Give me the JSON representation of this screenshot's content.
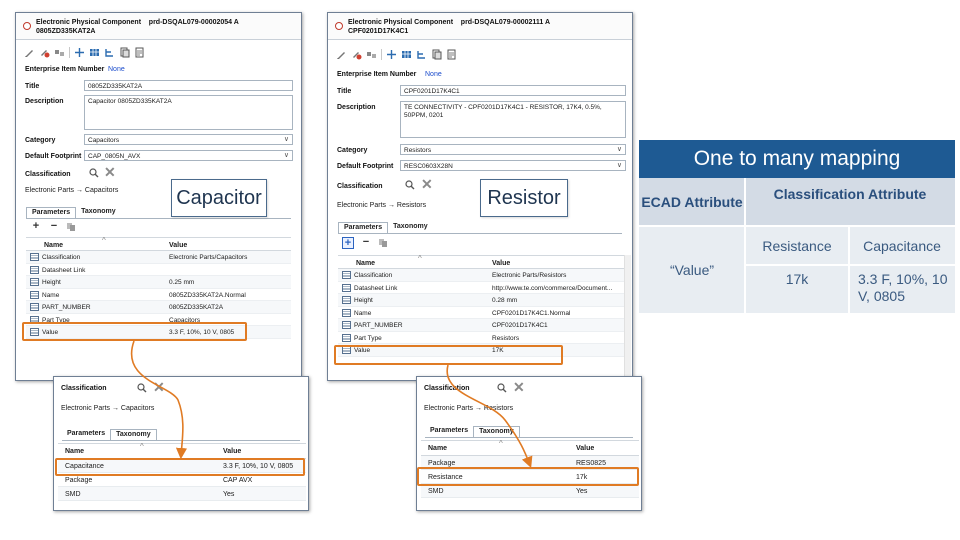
{
  "left_window": {
    "header": "Electronic Physical Component    prd-DSQAL079-00002054 A\n0805ZD335KAT2A",
    "enterprise_label": "Enterprise Item Number",
    "enterprise_value": "None",
    "title_label": "Title",
    "title_value": "0805ZD335KAT2A",
    "description_label": "Description",
    "description_value": "Capacitor 0805ZD335KAT2A",
    "category_label": "Category",
    "category_value": "Capacitors",
    "footprint_label": "Default Footprint",
    "footprint_value": "CAP_0805N_AVX",
    "classification_label": "Classification",
    "classification_path": "Electronic Parts → Capacitors",
    "tabs": [
      "Parameters",
      "Taxonomy"
    ],
    "grid_headers": [
      "Name",
      "Value"
    ],
    "rows": [
      {
        "name": "Classification",
        "value": "Electronic Parts/Capacitors"
      },
      {
        "name": "Datasheet Link",
        "value": ""
      },
      {
        "name": "Height",
        "value": "0.25 mm"
      },
      {
        "name": "Name",
        "value": "0805ZD335KAT2A.Normal"
      },
      {
        "name": "PART_NUMBER",
        "value": "0805ZD335KAT2A"
      },
      {
        "name": "Part Type",
        "value": "Capacitors"
      },
      {
        "name": "Value",
        "value": "3.3 F, 10%, 10 V, 0805"
      }
    ]
  },
  "right_window": {
    "header": "Electronic Physical Component    prd-DSQAL079-00002111 A\nCPF0201D17K4C1",
    "enterprise_label": "Enterprise Item Number",
    "enterprise_value": "None",
    "title_label": "Title",
    "title_value": "CPF0201D17K4C1",
    "description_label": "Description",
    "description_value": "TE CONNECTIVITY - CPF0201D17K4C1 - RESISTOR, 17K4, 0.5%, 50PPM, 0201",
    "category_label": "Category",
    "category_value": "Resistors",
    "footprint_label": "Default Footprint",
    "footprint_value": "RESC0603X28N",
    "classification_label": "Classification",
    "classification_path": "Electronic Parts → Resistors",
    "tabs": [
      "Parameters",
      "Taxonomy"
    ],
    "grid_headers": [
      "Name",
      "Value"
    ],
    "rows": [
      {
        "name": "Classification",
        "value": "Electronic Parts/Resistors"
      },
      {
        "name": "Datasheet Link",
        "value": "http://www.te.com/commerce/Document..."
      },
      {
        "name": "Height",
        "value": "0.28 mm"
      },
      {
        "name": "Name",
        "value": "CPF0201D17K4C1.Normal"
      },
      {
        "name": "PART_NUMBER",
        "value": "CPF0201D17K4C1"
      },
      {
        "name": "Part Type",
        "value": "Resistors"
      },
      {
        "name": "Value",
        "value": "17K"
      }
    ]
  },
  "callouts": {
    "capacitor": "Capacitor",
    "resistor": "Resistor"
  },
  "left_popup": {
    "classification_label": "Classification",
    "path": "Electronic Parts → Capacitors",
    "tabs": [
      "Parameters",
      "Taxonomy"
    ],
    "grid_headers": [
      "Name",
      "Value"
    ],
    "rows": [
      {
        "name": "Capacitance",
        "value": "3.3 F, 10%, 10 V, 0805"
      },
      {
        "name": "Package",
        "value": "CAP AVX"
      },
      {
        "name": "SMD",
        "value": "Yes"
      }
    ]
  },
  "right_popup": {
    "classification_label": "Classification",
    "path": "Electronic Parts → Resistors",
    "tabs": [
      "Parameters",
      "Taxonomy"
    ],
    "grid_headers": [
      "Name",
      "Value"
    ],
    "rows": [
      {
        "name": "Package",
        "value": "RES0825"
      },
      {
        "name": "Resistance",
        "value": "17k"
      },
      {
        "name": "SMD",
        "value": "Yes"
      }
    ]
  },
  "mapping": {
    "title": "One to many mapping",
    "ecad_header": "ECAD Attribute",
    "class_header": "Classification Attribute",
    "ecad_value": "“Value”",
    "attr_names": [
      "Resistance",
      "Capacitance"
    ],
    "attr_values": [
      "17k",
      "3.3 F, 10%, 10 V, 0805"
    ]
  },
  "colors": {
    "highlight": "#e07b24",
    "title_bar": "#1e5a93",
    "table_header": "#d3dbe5",
    "table_body": "#e8edf2"
  },
  "icons": [
    "pencil-icon",
    "edit-tag-icon",
    "link-icon",
    "move-icon",
    "table-icon",
    "tree-icon",
    "copy-icon",
    "report-icon",
    "search-icon",
    "close-icon",
    "add-icon",
    "remove-icon",
    "duplicate-icon",
    "row-icon"
  ]
}
